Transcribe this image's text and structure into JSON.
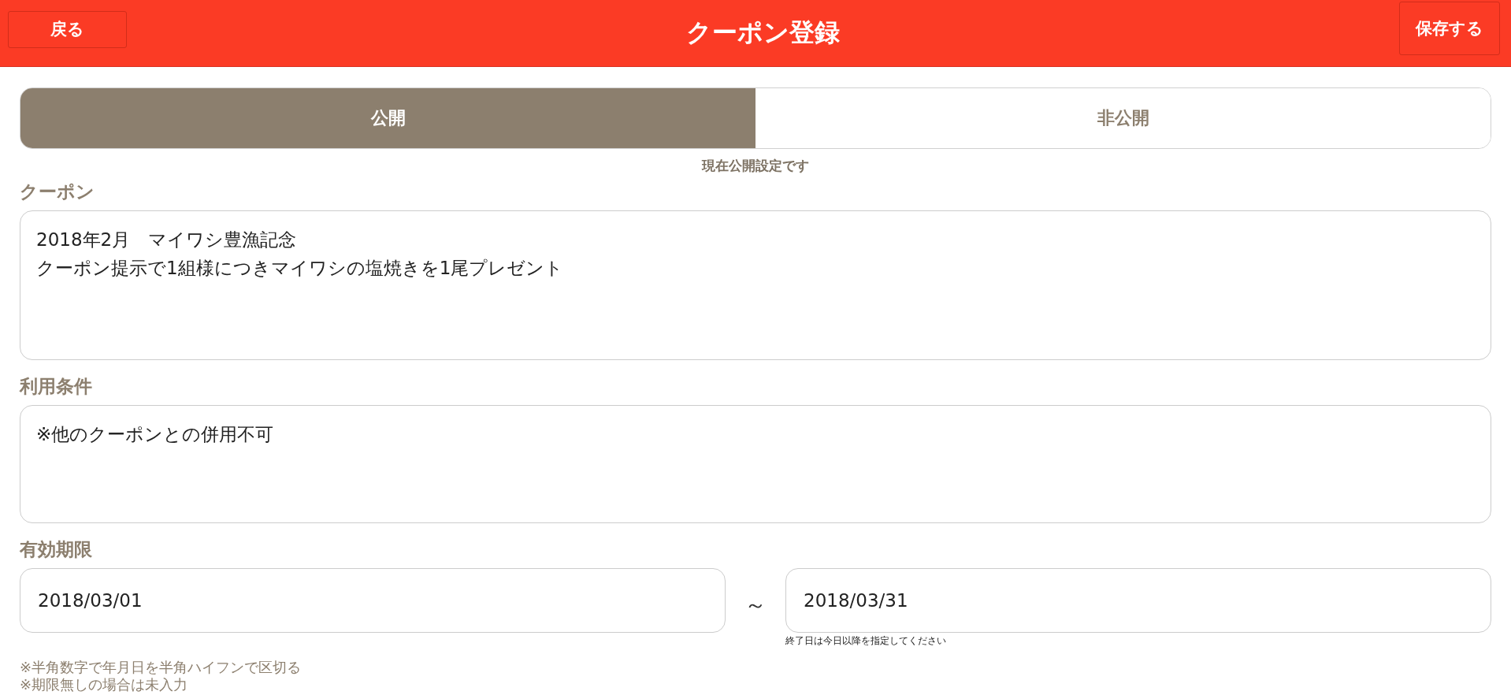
{
  "header": {
    "back_button": "戻る",
    "title": "クーポン登録",
    "save_button": "保存する"
  },
  "visibility": {
    "options": [
      {
        "label": "公開",
        "selected": true
      },
      {
        "label": "非公開",
        "selected": false
      }
    ],
    "caption": "現在公開設定です"
  },
  "coupon": {
    "label": "クーポン",
    "lines": [
      "2018年2月　マイワシ豊漁記念",
      "クーポン提示で1組様につきマイワシの塩焼きを1尾プレゼント"
    ]
  },
  "conditions": {
    "label": "利用条件",
    "value": "※他のクーポンとの併用不可"
  },
  "validity": {
    "label": "有効期限",
    "start": "2018/03/01",
    "separator": "～",
    "end": "2018/03/31",
    "end_hint": "終了日は今日以降を指定してください",
    "notes": [
      "※半角数字で年月日を半角ハイフンで区切る",
      "※期限無しの場合は未入力"
    ]
  }
}
